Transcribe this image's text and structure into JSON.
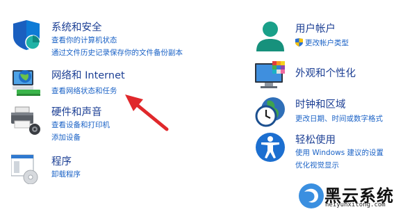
{
  "left": {
    "system": {
      "title": "系统和安全",
      "links": [
        "查看你的计算机状态",
        "通过文件历史记录保存你的文件备份副本"
      ]
    },
    "network": {
      "title": "网络和 Internet",
      "links": [
        "查看网络状态和任务"
      ]
    },
    "hardware": {
      "title": "硬件和声音",
      "links": [
        "查看设备和打印机",
        "添加设备"
      ]
    },
    "programs": {
      "title": "程序",
      "links": [
        "卸载程序"
      ]
    }
  },
  "right": {
    "accounts": {
      "title": "用户帐户",
      "links": [
        "更改帐户类型"
      ]
    },
    "appearance": {
      "title": "外观和个性化",
      "links": []
    },
    "clock": {
      "title": "时钟和区域",
      "links": [
        "更改日期、时间或数字格式"
      ]
    },
    "ease": {
      "title": "轻松使用",
      "links": [
        "使用 Windows 建议的设置",
        "优化视觉显示"
      ]
    }
  },
  "watermark": {
    "name": "黑云系统",
    "url": "heiyunxitong.com"
  },
  "colors": {
    "title": "#1c3f94",
    "link": "#1a62c6",
    "annotation_arrow": "#e0282b"
  }
}
